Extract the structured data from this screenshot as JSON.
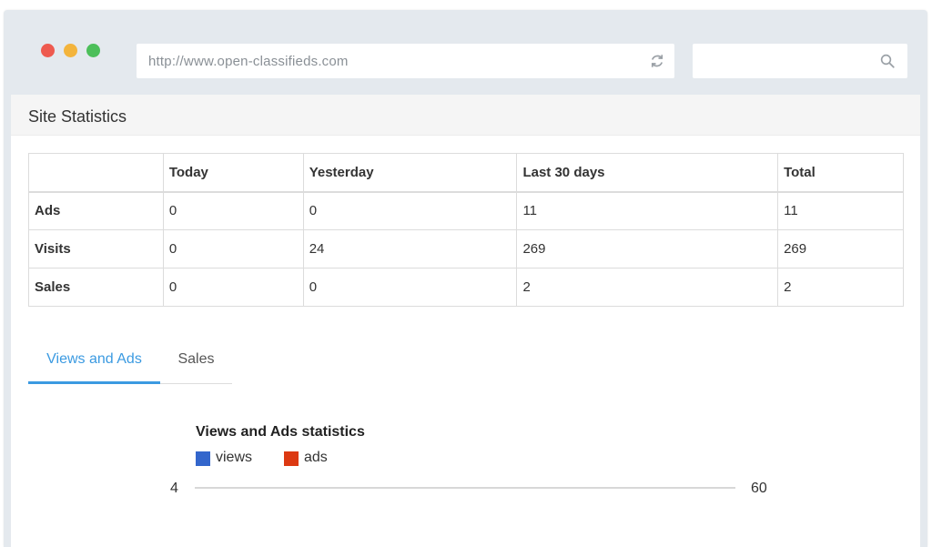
{
  "browser": {
    "url": "http://www.open-classifieds.com",
    "search_value": ""
  },
  "panel": {
    "title": "Site Statistics"
  },
  "table": {
    "headers": [
      "",
      "Today",
      "Yesterday",
      "Last 30 days",
      "Total"
    ],
    "rows": [
      {
        "label": "Ads",
        "cells": [
          "0",
          "0",
          "11",
          "11"
        ]
      },
      {
        "label": "Visits",
        "cells": [
          "0",
          "24",
          "269",
          "269"
        ]
      },
      {
        "label": "Sales",
        "cells": [
          "0",
          "0",
          "2",
          "2"
        ]
      }
    ]
  },
  "tabs": [
    {
      "label": "Views and Ads",
      "active": true
    },
    {
      "label": "Sales",
      "active": false
    }
  ],
  "icons": {
    "reload": "reload-icon",
    "search": "search-icon"
  },
  "colors": {
    "accent": "#3b9ae1",
    "views": "#3366cc",
    "ads": "#dc3912",
    "close": "#ee5a4f",
    "minimize": "#f3b43c",
    "maximize": "#4cbf5a"
  },
  "chart_data": {
    "type": "line",
    "title": "Views and Ads statistics",
    "series": [
      {
        "name": "views",
        "color": "#3366cc"
      },
      {
        "name": "ads",
        "color": "#dc3912"
      }
    ],
    "left_axis_value": "4",
    "right_axis_value": "60",
    "legend_position": "top"
  }
}
